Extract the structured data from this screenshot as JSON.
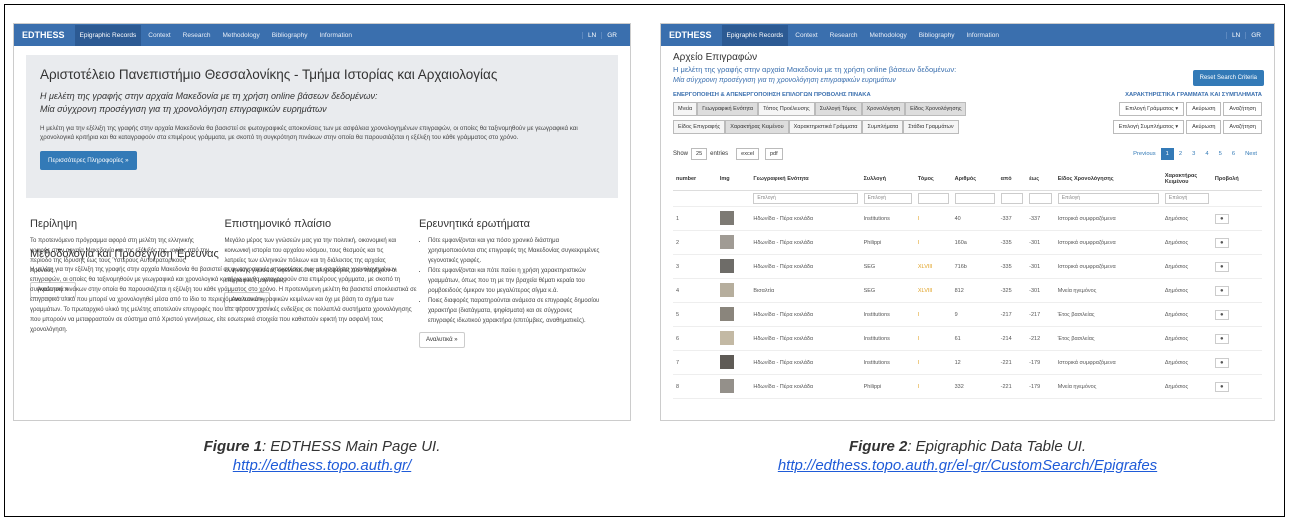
{
  "fig1": {
    "brand": "EDTHESS",
    "nav": [
      "Epigraphic Records",
      "Context",
      "Research",
      "Methodology",
      "Bibliography",
      "Information"
    ],
    "nav_right": [
      "LN",
      "GR"
    ],
    "title": "Αριστοτέλειο Πανεπιστήμιο Θεσσαλονίκης - Τμήμα Ιστορίας και Αρχαιολογίας",
    "sub1": "Η μελέτη της γραφής στην αρχαία Μακεδονία με τη χρήση online βάσεων δεδομένων:",
    "sub2": "Μία σύγχρονη προσέγγιση για τη χρονολόγηση επιγραφικών ευρημάτων",
    "intro": "Η μελέτη για την εξέλιξη της γραφής στην αρχαία Μακεδονία θα βασιστεί σε φωτογραφικές αποκονίσεις των με ασφάλεια χρονολογημένων επιγραφών, οι οποίες θα ταξινομηθούν με γεωγραφικά και χρονολογικά κριτήρια και θα καταγραφούν στα επιμέρους γράμματα, με σκοπό τη συγκρότηση πινάκων στην οποία θα παρουσιάζεται η εξέλιξη του κάθε γράμματος στο χρόνο.",
    "btn": "Περισσότερες Πληροφορίες »",
    "col1_h": "Περίληψη",
    "col1_p": "Το προτεινόμενο πρόγραμμα αφορά στη μελέτη της ελληνικής γραφής στην αρχαία Μακεδονία και της εξέλιξής της, ιορίας από την περίοδο της Ιδρυσης έως τους Ύστερους Αυτοκρατορικούς Χρόνους.",
    "col1_btn": "Αναλυτικά »",
    "col2_h": "Επιστημονικό πλαίσιο",
    "col2_p": "Μεγάλο μέρος των γνώσεών μας για την πολιτική, οικονομική και κοινωνική ιστορία του αρχαίου κόσμου, τους θεσμούς και τις λατρείες των ελληνικών πόλεων και τη διάλεκτος της αρχαίας ελληνικής γλώσσας οφείλεται στις πληροφορίες που παρέχουν οι επιγραφικές μαρτυρίες.",
    "col2_btn": "Αναλυτικά »",
    "col3_h": "Ερευνητικά ερωτήματα",
    "col3_items": [
      "Πότε εμφανίζονται και για πόσο χρονικό διάστημα χρησιμοποιούνται στις επιγραφές της Μακεδονίας συγκεκριμένες γεγονοτικές γραφές.",
      "Πότε εμφανίζονται και πότε παύει η χρήση χαρακτηριστικών γραμμάτων, όπως που τη με την βραχεία θέματι κεραία του ρομβοειδούς όμικρον του μεγαλύτερος σίγμα κ.ά.",
      "Ποιες διαφορές παρατηρούνται ανάμεσα σε επιγραφές δημοσίου χαρακτήρα (διατάγματα, ψηφίσματα) και σε σύγχρονες επιγραφές ιδιωτικού χαρακτήρα (επιτύμβιες, αναθηματικές)."
    ],
    "col3_btn": "Αναλυτικά »",
    "wide_h": "Μεθοδολογία και Προσέγγιση Έρευνας",
    "wide_p": "Η μελέτη για την εξέλιξη της γραφής στην αρχαία Μακεδονία θα βασιστεί σε φωτογραφικές αποκονίσεις των με ασφάλεια χρονολογημένων επιγραφών, οι οποίες θα ταξινομηθούν με γεωγραφικά και χρονολογικά κριτήρια και θα καταγραφούν στα επιμέρους γράμματα, με σκοπό τη συγκρότηση πινάκων στην οποία θα παρουσιάζεται η εξέλιξη του κάθε γράμματος στο χρόνο. Η προτεινόμενη μελέτη θα βασιστεί αποκλειστικά σε επιγραφικό υλικό που μπορεί να χρονολογηθεί μέσα από το ίδιο το περιεχόμενο των επιγραφικών κειμένων και όχι με βάση το σχήμα των γραμμάτων. Το πρωταρχικό υλικό της μελέτης αποτελούν επιγραφές που είτε φέρουν χρονικές ενδείξεις σε πολλαπλά συστήματα χρονολόγησης που μπορούν να μεταφραστούν σε σύστημα από Χριστού γεννήσεως, είτε εσωτερικά στοιχεία που καθιστούν εφικτή την ασφαλή τους χρονολόγηση."
  },
  "fig2": {
    "brand": "EDTHESS",
    "nav": [
      "Epigraphic Records",
      "Context",
      "Research",
      "Methodology",
      "Bibliography",
      "Information"
    ],
    "nav_right": [
      "LN",
      "GR"
    ],
    "title": "Αρχείο Επιγραφών",
    "sub1": "Η μελέτη της γραφής στην αρχαία Μακεδονία με τη χρήση online βάσεων δεδομένων:",
    "sub2": "Μία σύγχρονη προσέγγιση για τη χρονολόγηση επιγραφικών ευρημάτων",
    "reset": "Reset Search Criteria",
    "sec_left": "ΕΝΕΡΓΟΠΟΙΗΣΗ & ΑΠΕΝΕΡΓΟΠΟΙΗΣΗ ΕΠΙΛΟΓΩΝ ΠΡΟΒΟΛΗΣ ΠΙΝΑΚΑ",
    "sec_right": "ΧΑΡΑΚΤΗΡΙΣΤΙΚΑ ΓΡΑΜΜΑΤΑ ΚΑΙ ΣΥΜΠΛΗΜΑΤΑ",
    "toggles1": [
      "Μνεία",
      "Γεωγραφική Ενότητα",
      "Τόπος Προέλευσης",
      "Συλλογή Τόμος",
      "Χρονολόγηση",
      "Είδος Χρονολόγησης"
    ],
    "toggles2": [
      "Είδος Επιγραφής",
      "Χαρακτήρας Κειμένου",
      "Χαρακτηριστικά Γράμματα",
      "Συμπλήματα",
      "Στάδια Γραμμάτων"
    ],
    "right1": [
      "Επιλογή Γράμματος ▾",
      "Ακύρωση",
      "Αναζήτηση"
    ],
    "right2": [
      "Επιλογή Συμπλήματος ▾",
      "Ακύρωση",
      "Αναζήτηση"
    ],
    "show": "Show",
    "entries_num": "25",
    "entries": "entries",
    "excel": "excel",
    "pdf": "pdf",
    "pager": [
      "Previous",
      "1",
      "2",
      "3",
      "4",
      "5",
      "6",
      "Next"
    ],
    "headers": [
      "number",
      "Img",
      "Γεωγραφική Ενότητα",
      "Συλλογή",
      "Τόμος",
      "Αριθμός",
      "από",
      "έως",
      "Είδος Χρονολόγησης",
      "Χαρακτήρας Κειμένου",
      "Προβολή"
    ],
    "filter_select": "Επιλογή",
    "rows": [
      [
        "1",
        "Ηδωνίδα - Πέρα κοιλάδα",
        "Institutions",
        "I",
        "40",
        "-337",
        "-337",
        "Ιστορικά συμφραζόμενα",
        "Δημόσιος"
      ],
      [
        "2",
        "Ηδωνίδα - Πέρα κοιλάδα",
        "Philippi",
        "I",
        "160a",
        "-335",
        "-301",
        "Ιστορικά συμφραζόμενα",
        "Δημόσιος"
      ],
      [
        "3",
        "Ηδωνίδα - Πέρα κοιλάδα",
        "SEG",
        "XLVIII",
        "716b",
        "-335",
        "-301",
        "Ιστορικά συμφραζόμενα",
        "Δημόσιος"
      ],
      [
        "4",
        "Βισαλτία",
        "SEG",
        "XLVIII",
        "812",
        "-325",
        "-301",
        "Μνεία ηγεμόνος",
        "Δημόσιος"
      ],
      [
        "5",
        "Ηδωνίδα - Πέρα κοιλάδα",
        "Institutions",
        "I",
        "9",
        "-217",
        "-217",
        "Έτος βασιλείας",
        "Δημόσιος"
      ],
      [
        "6",
        "Ηδωνίδα - Πέρα κοιλάδα",
        "Institutions",
        "I",
        "61",
        "-214",
        "-212",
        "Έτος βασιλείας",
        "Δημόσιος"
      ],
      [
        "7",
        "Ηδωνίδα - Πέρα κοιλάδα",
        "Institutions",
        "I",
        "12",
        "-221",
        "-179",
        "Ιστορικά συμφραζόμενα",
        "Δημόσιος"
      ],
      [
        "8",
        "Ηδωνίδα - Πέρα κοιλάδα",
        "Philippi",
        "I",
        "332",
        "-221",
        "-179",
        "Μνεία ηγεμόνος",
        "Δημόσιος"
      ]
    ]
  },
  "captions": {
    "fig1_label": "Figure 1",
    "fig1_text": ": EDTHESS Main Page UI.",
    "fig1_url": "http://edthess.topo.auth.gr/",
    "fig2_label": "Figure 2",
    "fig2_text": ": Epigraphic Data Table UI.",
    "fig2_url": "http://edthess.topo.auth.gr/el-gr/CustomSearch/Epigrafes"
  }
}
